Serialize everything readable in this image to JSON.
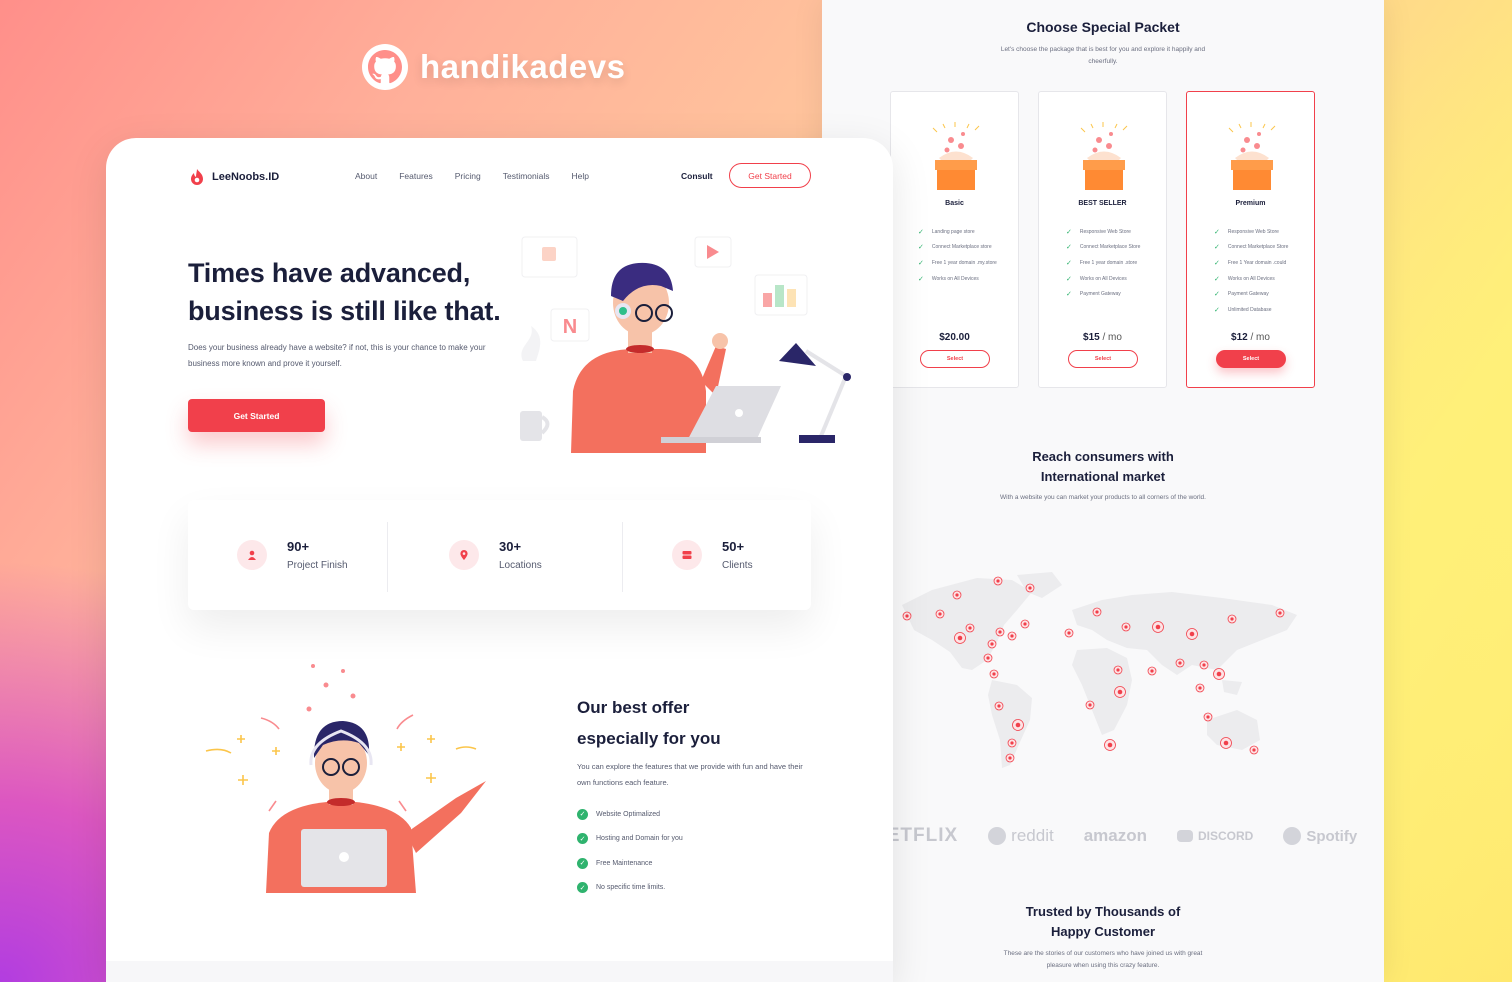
{
  "brand": {
    "name": "handikadevs",
    "icon": "github-icon"
  },
  "colors": {
    "accent": "#f1404b",
    "check": "#2fb36e",
    "dark": "#1b1f3b"
  },
  "nav": {
    "logo": "LeeNoobs.ID",
    "links": [
      "About",
      "Features",
      "Pricing",
      "Testimonials",
      "Help"
    ],
    "consult": "Consult",
    "cta": "Get Started"
  },
  "hero": {
    "title_line1": "Times have advanced,",
    "title_line2": "business is still like that.",
    "description": "Does your business already have a website? if not, this is your chance to make your business more known and prove it yourself.",
    "button": "Get Started"
  },
  "stats": [
    {
      "value": "90+",
      "label": "Project Finish",
      "icon": "user-icon"
    },
    {
      "value": "30+",
      "label": "Locations",
      "icon": "location-pin-icon"
    },
    {
      "value": "50+",
      "label": "Clients",
      "icon": "server-icon"
    }
  ],
  "offer": {
    "title_line1": "Our best offer",
    "title_line2": "especially for you",
    "description": "You can explore the features that we provide with fun and have their own functions each feature.",
    "features": [
      "Website Optimalized",
      "Hosting and Domain for you",
      "Free Maintenance",
      "No specific time limits."
    ]
  },
  "pricing": {
    "title": "Choose Special Packet",
    "subtitle": "Let's choose the package that is best for you and explore it happily and cheerfully.",
    "plans": [
      {
        "name": "Basic",
        "features": [
          "Landing page store",
          "Connect Marketplace store",
          "Free 1 year domain .my.store",
          "Works on All Devices"
        ],
        "price": "$20.00",
        "unit": "",
        "button": "Select"
      },
      {
        "name": "BEST SELLER",
        "features": [
          "Responsive Web Store",
          "Connect Marketplace Store",
          "Free 1 year domain .store",
          "Works on All Devices",
          "Payment Gateway"
        ],
        "price": "$15",
        "unit": " / mo",
        "button": "Select"
      },
      {
        "name": "Premium",
        "features": [
          "Responsive Web Store",
          "Connect Marketplace Store",
          "Free 1 Year domain .could",
          "Works on All Devices",
          "Payment Gateway",
          "Unlimited Database"
        ],
        "price": "$12",
        "unit": " / mo",
        "button": "Select"
      }
    ]
  },
  "market": {
    "title_line1": "Reach consumers with",
    "title_line2": "International market",
    "subtitle": "With a website you can market your products to all corners of the world."
  },
  "logos": [
    "NETFLIX",
    "reddit",
    "amazon",
    "DISCORD",
    "Spotify"
  ],
  "testimonials": {
    "title_line1": "Trusted by Thousands of",
    "title_line2": "Happy Customer",
    "subtitle": "These are the stories of our customers who have joined us with great pleasure when using this crazy feature."
  }
}
